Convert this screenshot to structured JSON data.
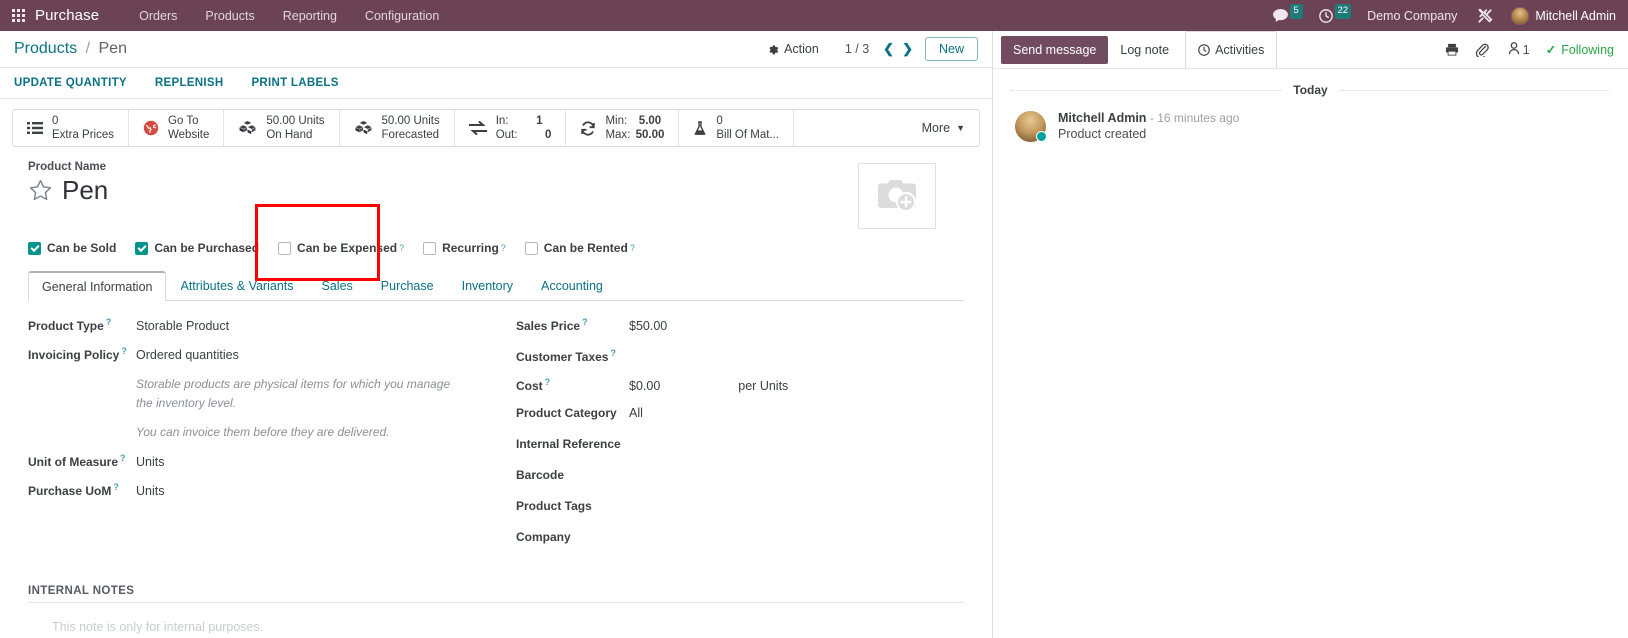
{
  "navbar": {
    "apps_icon": "apps-grid-icon",
    "brand": "Purchase",
    "menus": [
      {
        "label": "Orders"
      },
      {
        "label": "Products"
      },
      {
        "label": "Reporting"
      },
      {
        "label": "Configuration"
      }
    ],
    "messages_icon": "chat-bubble-icon",
    "messages_count": "5",
    "activities_icon": "clock-icon",
    "activities_count": "22",
    "company": "Demo Company",
    "tools_icon": "wrench-screwdriver-icon",
    "user": "Mitchell Admin",
    "badge_color": "#1f7a7a",
    "bar_color": "#6b4355"
  },
  "control_panel": {
    "breadcrumb_root": "Products",
    "breadcrumb_sep": "/",
    "breadcrumb_current": "Pen",
    "action_label": "Action",
    "action_icon": "gear-icon",
    "pager": "1 / 3",
    "prev_icon": "chevron-left-icon",
    "next_icon": "chevron-right-icon",
    "new_label": "New"
  },
  "button_bar": [
    {
      "label": "UPDATE QUANTITY",
      "name": "update-quantity-button"
    },
    {
      "label": "REPLENISH",
      "name": "replenish-button"
    },
    {
      "label": "PRINT LABELS",
      "name": "print-labels-button"
    }
  ],
  "stat_buttons": [
    {
      "icon": "list-icon",
      "value": "0",
      "label": "Extra Prices",
      "name": "stat-extra-prices"
    },
    {
      "icon": "globe-icon",
      "value": "Go To",
      "label": "Website",
      "name": "stat-go-to-website"
    },
    {
      "icon": "boxes-icon",
      "value": "50.00 Units",
      "label": "On Hand",
      "name": "stat-on-hand",
      "highlighted": true
    },
    {
      "icon": "boxes-icon",
      "value": "50.00 Units",
      "label": "Forecasted",
      "name": "stat-forecasted"
    },
    {
      "icon": "exchange-icon",
      "rows": [
        [
          "In:",
          "1"
        ],
        [
          "Out:",
          "0"
        ]
      ],
      "name": "stat-in-out"
    },
    {
      "icon": "refresh-icon",
      "rows": [
        [
          "Min:",
          "5.00"
        ],
        [
          "Max:",
          "50.00"
        ]
      ],
      "name": "stat-min-max"
    },
    {
      "icon": "flask-icon",
      "value": "0",
      "label": "Bill Of Mat...",
      "name": "stat-bill-of-materials"
    }
  ],
  "more_label": "More",
  "highlight_color": "#ff0000",
  "product": {
    "name_label": "Product Name",
    "name": "Pen",
    "star_icon": "star-outline-icon",
    "image_placeholder_icon": "camera-plus-icon"
  },
  "checkboxes": [
    {
      "label": "Can be Sold",
      "checked": true,
      "help": false,
      "name": "checkbox-can-be-sold"
    },
    {
      "label": "Can be Purchased",
      "checked": true,
      "help": false,
      "name": "checkbox-can-be-purchased"
    },
    {
      "label": "Can be Expensed",
      "checked": false,
      "help": true,
      "name": "checkbox-can-be-expensed"
    },
    {
      "label": "Recurring",
      "checked": false,
      "help": true,
      "name": "checkbox-recurring"
    },
    {
      "label": "Can be Rented",
      "checked": false,
      "help": true,
      "name": "checkbox-can-be-rented"
    }
  ],
  "tabs": [
    {
      "label": "General Information",
      "active": true,
      "name": "tab-general-information"
    },
    {
      "label": "Attributes & Variants",
      "active": false,
      "name": "tab-attributes-variants"
    },
    {
      "label": "Sales",
      "active": false,
      "name": "tab-sales"
    },
    {
      "label": "Purchase",
      "active": false,
      "name": "tab-purchase"
    },
    {
      "label": "Inventory",
      "active": false,
      "name": "tab-inventory"
    },
    {
      "label": "Accounting",
      "active": false,
      "name": "tab-accounting"
    }
  ],
  "left_fields": {
    "product_type_label": "Product Type",
    "product_type_value": "Storable Product",
    "invoicing_policy_label": "Invoicing Policy",
    "invoicing_policy_value": "Ordered quantities",
    "note1": "Storable products are physical items for which you manage the inventory level.",
    "note2": "You can invoice them before they are delivered.",
    "uom_label": "Unit of Measure",
    "uom_value": "Units",
    "purchase_uom_label": "Purchase UoM",
    "purchase_uom_value": "Units"
  },
  "right_fields": {
    "sales_price_label": "Sales Price",
    "sales_price_value": "$50.00",
    "customer_taxes_label": "Customer Taxes",
    "customer_taxes_value": "",
    "cost_label": "Cost",
    "cost_value": "$0.00",
    "cost_suffix": "per Units",
    "product_category_label": "Product Category",
    "product_category_value": "All",
    "internal_reference_label": "Internal Reference",
    "internal_reference_value": "",
    "barcode_label": "Barcode",
    "barcode_value": "",
    "product_tags_label": "Product Tags",
    "product_tags_value": "",
    "company_label": "Company",
    "company_value": ""
  },
  "internal_notes": {
    "header": "INTERNAL NOTES",
    "placeholder": "This note is only for internal purposes."
  },
  "chatter": {
    "send_message": "Send message",
    "log_note": "Log note",
    "activities": "Activities",
    "activities_icon": "clock-icon",
    "print_icon": "printer-icon",
    "attachment_icon": "paperclip-icon",
    "followers_icon": "user-icon",
    "followers_count": "1",
    "following_label": "Following",
    "following_color": "#28a745",
    "day_divider": "Today",
    "messages": [
      {
        "author": "Mitchell Admin",
        "time": "- 16 minutes ago",
        "body": "Product created"
      }
    ]
  }
}
